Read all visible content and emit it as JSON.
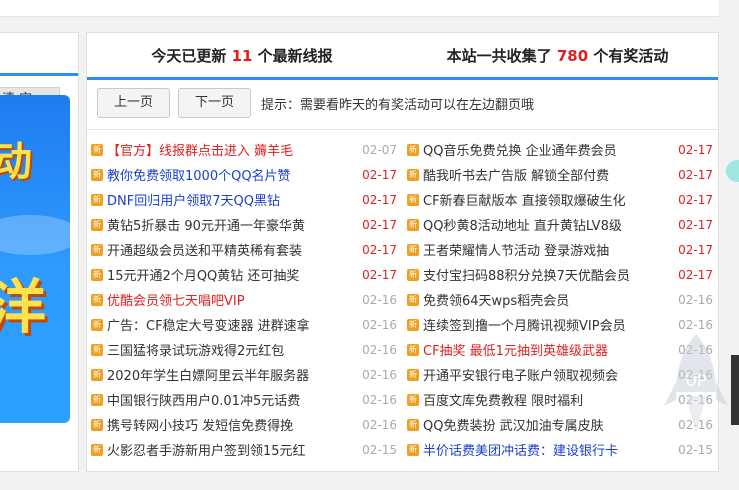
{
  "left": {
    "clear_label": "清 空",
    "promo_glyph_top": "动",
    "promo_glyph_bottom": "洋"
  },
  "header": {
    "left_prefix": "今天已更新",
    "left_count": "11",
    "left_suffix": "个最新线报",
    "right_prefix": "本站一共收集了",
    "right_count": "780",
    "right_suffix": "个有奖活动"
  },
  "controls": {
    "prev": "上一页",
    "next": "下一页",
    "hint": "提示：需要看昨天的有奖活动可以在左边翻页哦"
  },
  "left_items": [
    {
      "title": "【官方】线报群点击进入 薅羊毛",
      "date": "02-07",
      "color": "red",
      "date_color": "gray"
    },
    {
      "title": "教你免费领取1000个QQ名片赞",
      "date": "02-17",
      "color": "blue",
      "date_color": "red"
    },
    {
      "title": "DNF回归用户领取7天QQ黑钻",
      "date": "02-17",
      "color": "blue",
      "date_color": "red"
    },
    {
      "title": "黄钻5折暴击 90元开通一年豪华黄",
      "date": "02-17",
      "color": "ink",
      "date_color": "red"
    },
    {
      "title": "开通超级会员送和平精英稀有套装",
      "date": "02-17",
      "color": "ink",
      "date_color": "red"
    },
    {
      "title": "15元开通2个月QQ黄钻 还可抽奖",
      "date": "02-17",
      "color": "ink",
      "date_color": "red"
    },
    {
      "title": "优酷会员领七天唱吧VIP",
      "date": "02-16",
      "color": "red",
      "date_color": "gray"
    },
    {
      "title": "广告：CF稳定大号变速器 进群速拿",
      "date": "02-16",
      "color": "ink",
      "date_color": "gray"
    },
    {
      "title": "三国猛将录试玩游戏得2元红包",
      "date": "02-16",
      "color": "ink",
      "date_color": "gray"
    },
    {
      "title": "2020年学生白嫖阿里云半年服务器",
      "date": "02-16",
      "color": "ink",
      "date_color": "gray"
    },
    {
      "title": "中国银行陕西用户0.01冲5元话费",
      "date": "02-16",
      "color": "ink",
      "date_color": "gray"
    },
    {
      "title": "携号转网小技巧 发短信免费得挽",
      "date": "02-16",
      "color": "ink",
      "date_color": "gray"
    },
    {
      "title": "火影忍者手游新用户签到领15元红",
      "date": "02-15",
      "color": "ink",
      "date_color": "gray"
    }
  ],
  "right_items": [
    {
      "title": "QQ音乐免费兑换 企业通年费会员",
      "date": "02-17",
      "color": "ink",
      "date_color": "red"
    },
    {
      "title": "酷我听书去广告版 解锁全部付费",
      "date": "02-17",
      "color": "ink",
      "date_color": "red"
    },
    {
      "title": "CF新春巨献版本 直接领取爆破生化",
      "date": "02-17",
      "color": "ink",
      "date_color": "red"
    },
    {
      "title": "QQ秒黄8活动地址 直升黄钻LV8级",
      "date": "02-17",
      "color": "ink",
      "date_color": "red"
    },
    {
      "title": "王者荣耀情人节活动 登录游戏抽",
      "date": "02-17",
      "color": "ink",
      "date_color": "red"
    },
    {
      "title": "支付宝扫码88积分兑换7天优酷会员",
      "date": "02-17",
      "color": "ink",
      "date_color": "red"
    },
    {
      "title": "免费领64天wps稻壳会员",
      "date": "02-16",
      "color": "ink",
      "date_color": "gray"
    },
    {
      "title": "连续签到撸一个月腾讯视频VIP会员",
      "date": "02-16",
      "color": "ink",
      "date_color": "gray"
    },
    {
      "title": "CF抽奖 最低1元抽到英雄级武器",
      "date": "02-16",
      "color": "red",
      "date_color": "gray"
    },
    {
      "title": "开通平安银行电子账户领取视频会",
      "date": "02-16",
      "color": "ink",
      "date_color": "gray"
    },
    {
      "title": "百度文库免费教程 限时福利",
      "date": "02-16",
      "color": "ink",
      "date_color": "gray"
    },
    {
      "title": "QQ免费装扮 武汉加油专属皮肤",
      "date": "02-16",
      "color": "ink",
      "date_color": "gray"
    },
    {
      "title": "半价话费美团冲话费：建设银行卡",
      "date": "02-15",
      "color": "blue",
      "date_color": "gray"
    }
  ],
  "icon_glyph": "新",
  "rocket_label": "UP",
  "colors": {
    "accent": "#2d8ef0",
    "highlight": "#e02020",
    "link_blue": "#1a3fd0",
    "icon": "#f0a020"
  }
}
